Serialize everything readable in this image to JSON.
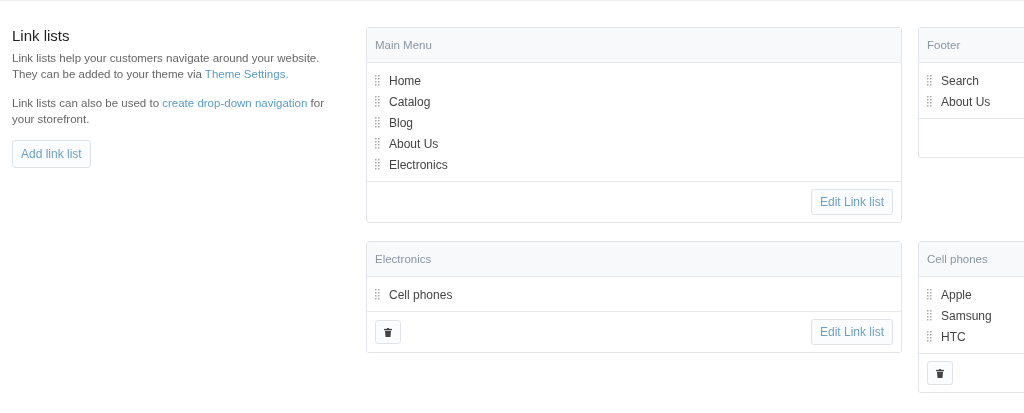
{
  "intro": {
    "title": "Link lists",
    "paragraphs": [
      [
        {
          "text": "Link lists help your customers navigate around your website. They can be added to your theme via ",
          "link": false
        },
        {
          "text": "Theme Settings.",
          "link": true
        }
      ],
      [
        {
          "text": "Link lists can also be used to ",
          "link": false
        },
        {
          "text": "create drop-down navigation",
          "link": true
        },
        {
          "text": " for your storefront.",
          "link": false
        }
      ]
    ],
    "button": "Add link list"
  },
  "link_lists": [
    {
      "title": "Main Menu",
      "items": [
        "Home",
        "Catalog",
        "Blog",
        "About Us",
        "Electronics"
      ],
      "delete_button": false,
      "edit_button": "Edit Link list"
    },
    {
      "title": "Footer",
      "items": [
        "Search",
        "About Us"
      ],
      "delete_button": false
    },
    {
      "title": "Electronics",
      "items": [
        "Cell phones"
      ],
      "delete_button": true,
      "edit_button": "Edit Link list"
    },
    {
      "title": "Cell phones",
      "items": [
        "Apple",
        "Samsung",
        "HTC"
      ],
      "delete_button": true
    }
  ]
}
